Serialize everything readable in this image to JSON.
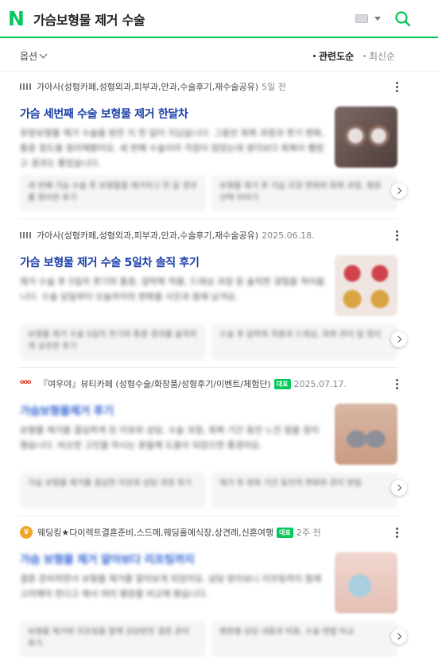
{
  "search": {
    "query": "가슴보형물 제거 수술"
  },
  "options": {
    "label": "옵션",
    "sort_relevance": "관련도순",
    "sort_latest": "최신순"
  },
  "posts": [
    {
      "source": "가아사(성형카페,성형외과,피부과,안과,수술후기,재수술공유)",
      "date": "5일 전",
      "title": "가슴 세번째 수술 보형물 제거 한달차",
      "snippet": "유방보형물 제거 수술을 받은 지 한 달이 지났습니다. 그동안 회복 과정과 붓기 변화, 통증 정도를 정리해봤어요. 세 번째 수술이라 걱정이 많았는데 생각보다 회복이 빨랐고 경과도 좋았습니다.",
      "related": [
        "세 번째 가슴 수술 후 보형물을 제거하고 한 달 경과를 정리한 후기",
        "보형물 제거 후 가슴 모양 변화와 회복 과정, 병원 선택 이야기"
      ]
    },
    {
      "source": "가아사(성형카페,성형외과,피부과,안과,수술후기,재수술공유)",
      "date": "2025.06.18.",
      "title": "가슴 보형물 제거 수술 5일차 솔직 후기",
      "snippet": "제거 수술 후 5일차 붓기와 통증, 압박복 착용, 드레싱 과정 등 솔직한 경험을 적어봅니다. 수술 당일부터 오늘까지의 변화를 사진과 함께 남겨요.",
      "related": [
        "보형물 제거 수술 5일차 붓기와 통증 경과를 솔직하게 공유한 후기",
        "수술 후 압박복 착용과 드레싱, 회복 관리 팁 정리"
      ]
    },
    {
      "source": "『여우야』뷰티카페 (성형수술/화장품/성형후기/이벤트/체험단)",
      "badge": "대표",
      "date": "2025.07.17.",
      "title": "가슴보형물제거 후기",
      "snippet": "보형물 제거를 결심하게 된 이유와 상담, 수술 과정, 회복 기간 동안 느낀 점을 정리했습니다. 비슷한 고민을 하시는 분들께 도움이 되었으면 좋겠어요.",
      "related": [
        "가슴 보형물 제거를 결심한 이유와 상담 과정 후기",
        "제거 후 회복 기간 동안의 변화와 관리 방법"
      ]
    },
    {
      "source": "웨딩킹★다이렉트결혼준비,스드메,웨딩홀예식장,상견례,신혼여행",
      "badge": "대표",
      "date": "2주 전",
      "title": "가슴 보형물 제거 알아보다 리프팅까지",
      "snippet": "결혼 준비하면서 보형물 제거를 알아보게 되었어요. 상담 받아보니 리프팅까지 함께 고려해야 한다고 해서 여러 병원을 비교해 봤습니다.",
      "related": [
        "보형물 제거와 리프팅을 함께 상담받은 결혼 준비 후기",
        "병원별 상담 내용과 비용, 수술 방법 비교"
      ]
    }
  ],
  "colors": {
    "brand_green": "#03c75a",
    "title_blue": "#1a3fa8"
  },
  "icons": [
    "naver-logo-icon",
    "keyboard-icon",
    "caret-down-icon",
    "search-icon",
    "more-icon",
    "next-arrow-icon"
  ]
}
